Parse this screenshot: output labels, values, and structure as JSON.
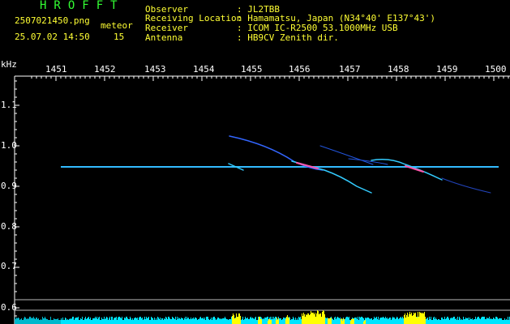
{
  "header": {
    "app_title": "HROFFT",
    "filename": "2507021450.png",
    "mode": "meteor",
    "datetime": "25.07.02 14:50",
    "count": "15",
    "fields": [
      {
        "label": "Observer",
        "value": ": JL2TBB"
      },
      {
        "label": "Receiving Location",
        "value": ": Hamamatsu, Japan (N34°40' E137°43')"
      },
      {
        "label": "Receiver",
        "value": ": ICOM IC-R2500 53.1000MHz USB"
      },
      {
        "label": "Antenna",
        "value": ": HB9CV Zenith dir."
      }
    ]
  },
  "axis": {
    "unit": "kHz",
    "x_ticks": [
      "1451",
      "1452",
      "1453",
      "1454",
      "1455",
      "1456",
      "1457",
      "1458",
      "1459",
      "1500"
    ],
    "y_ticks": [
      "1.1",
      "1.0",
      "0.9",
      "0.8",
      "0.7",
      "0.6"
    ]
  },
  "colors": {
    "green": "#33ff33",
    "yellow": "#ffff33",
    "signal": "#33ccff",
    "noise": "#00e5ff",
    "burst": "#ffff00"
  }
}
